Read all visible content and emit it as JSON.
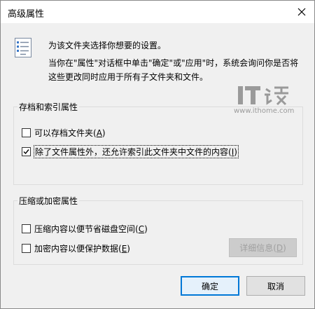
{
  "window": {
    "title": "高级属性"
  },
  "intro": {
    "line1": "为该文件夹选择你想要的设置。",
    "line2": "当你在\"属性\"对话框中单击\"确定\"或\"应用\"时，系统会询问你是否将这些更改同时应用于所有子文件夹和文件。"
  },
  "watermark": {
    "logo": "IT之家",
    "url": "www.ithome.com"
  },
  "archive_group": {
    "title": "存档和索引属性",
    "items": [
      {
        "label": "可以存档文件夹(",
        "accel": "A",
        "end": ")",
        "checked": false
      },
      {
        "label": "除了文件属性外，还允许索引此文件夹中文件的内容(",
        "accel": "I",
        "end": ")",
        "checked": true
      }
    ]
  },
  "compress_group": {
    "title": "压缩或加密属性",
    "items": [
      {
        "label": "压缩内容以便节省磁盘空间(",
        "accel": "C",
        "end": ")",
        "checked": false
      },
      {
        "label": "加密内容以便保护数据(",
        "accel": "E",
        "end": ")",
        "checked": false
      }
    ],
    "details_button": {
      "label": "详细信息(",
      "accel": "D",
      "end": ")"
    }
  },
  "buttons": {
    "ok": "确定",
    "cancel": "取消"
  },
  "colors": {
    "accent": "#0078d7",
    "dialog_bg": "#f0f0f0"
  }
}
